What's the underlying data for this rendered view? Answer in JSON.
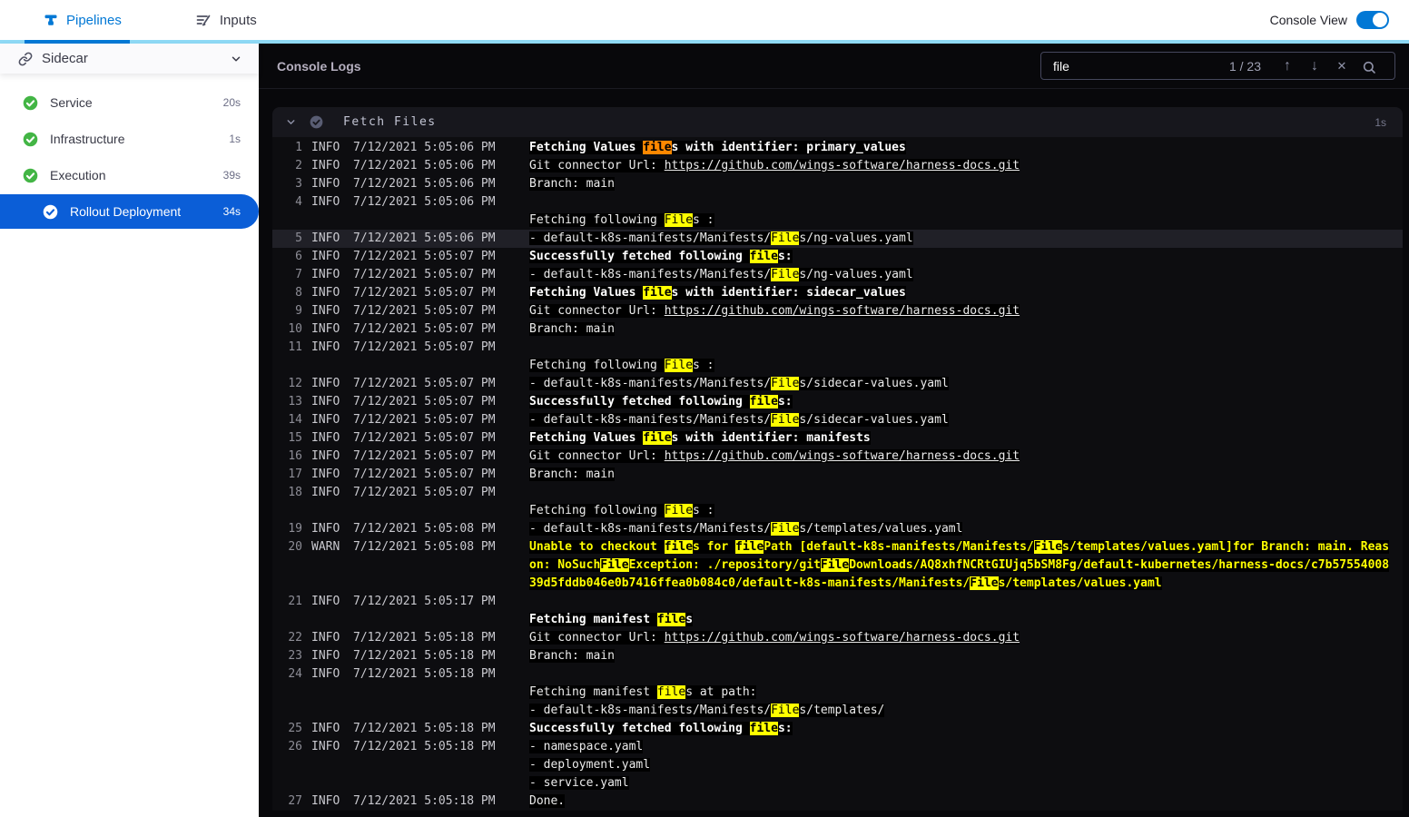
{
  "header": {
    "tabs": [
      {
        "label": "Pipelines",
        "icon": "pipeline-icon",
        "active": true
      },
      {
        "label": "Inputs",
        "icon": "inputs-icon",
        "active": false
      }
    ],
    "console_view_label": "Console View",
    "console_view_on": true
  },
  "sidebar": {
    "stage": {
      "label": "Sidecar",
      "icon": "link-icon"
    },
    "steps": [
      {
        "label": "Service",
        "duration": "20s",
        "status": "success",
        "selected": false
      },
      {
        "label": "Infrastructure",
        "duration": "1s",
        "status": "success",
        "selected": false
      },
      {
        "label": "Execution",
        "duration": "39s",
        "status": "success",
        "selected": false
      },
      {
        "label": "Rollout Deployment",
        "duration": "34s",
        "status": "success",
        "selected": true
      }
    ]
  },
  "console": {
    "title": "Console Logs",
    "search": {
      "value": "file",
      "counter": "1 / 23"
    },
    "section": {
      "title": "Fetch Files",
      "duration": "1s"
    }
  },
  "colors": {
    "accent_blue": "#0278d5",
    "selected_step_blue": "#0b5ed7",
    "success_green": "#43b545",
    "match_highlight": "#ffff00",
    "current_match_highlight": "#ff8800",
    "warn_text": "#ffff00"
  },
  "log": {
    "entries": [
      {
        "num": 1,
        "level": "INFO",
        "time": "7/12/2021 5:05:06 PM",
        "lines": [
          [
            {
              "t": "Fetching Values ",
              "b": 1
            },
            {
              "t": "file",
              "b": 1,
              "m": "current"
            },
            {
              "t": "s with identifier: primary_values",
              "b": 1
            }
          ]
        ]
      },
      {
        "num": 2,
        "level": "INFO",
        "time": "7/12/2021 5:05:06 PM",
        "lines": [
          [
            {
              "t": "Git connector Url: "
            },
            {
              "t": "https://github.com/wings-software/harness-docs.git",
              "link": 1
            }
          ]
        ]
      },
      {
        "num": 3,
        "level": "INFO",
        "time": "7/12/2021 5:05:06 PM",
        "lines": [
          [
            {
              "t": "Branch: main"
            }
          ]
        ]
      },
      {
        "num": 4,
        "level": "INFO",
        "time": "7/12/2021 5:05:06 PM",
        "lines": [
          [],
          [
            {
              "t": "Fetching following "
            },
            {
              "t": "File",
              "m": "match"
            },
            {
              "t": "s :"
            }
          ]
        ]
      },
      {
        "num": 5,
        "level": "INFO",
        "time": "7/12/2021 5:05:06 PM",
        "row_highlight": true,
        "lines": [
          [
            {
              "t": "- default-k8s-manifests/Manifests/"
            },
            {
              "t": "File",
              "m": "match"
            },
            {
              "t": "s/ng-values.yaml"
            }
          ]
        ]
      },
      {
        "num": 6,
        "level": "INFO",
        "time": "7/12/2021 5:05:07 PM",
        "lines": [
          [
            {
              "t": "Successfully fetched following ",
              "b": 1
            },
            {
              "t": "file",
              "b": 1,
              "m": "match"
            },
            {
              "t": "s:",
              "b": 1
            }
          ]
        ]
      },
      {
        "num": 7,
        "level": "INFO",
        "time": "7/12/2021 5:05:07 PM",
        "lines": [
          [
            {
              "t": "- default-k8s-manifests/Manifests/"
            },
            {
              "t": "File",
              "m": "match"
            },
            {
              "t": "s/ng-values.yaml"
            }
          ]
        ]
      },
      {
        "num": 8,
        "level": "INFO",
        "time": "7/12/2021 5:05:07 PM",
        "lines": [
          [
            {
              "t": "Fetching Values ",
              "b": 1
            },
            {
              "t": "file",
              "b": 1,
              "m": "match"
            },
            {
              "t": "s with identifier: sidecar_values",
              "b": 1
            }
          ]
        ]
      },
      {
        "num": 9,
        "level": "INFO",
        "time": "7/12/2021 5:05:07 PM",
        "lines": [
          [
            {
              "t": "Git connector Url: "
            },
            {
              "t": "https://github.com/wings-software/harness-docs.git",
              "link": 1
            }
          ]
        ]
      },
      {
        "num": 10,
        "level": "INFO",
        "time": "7/12/2021 5:05:07 PM",
        "lines": [
          [
            {
              "t": "Branch: main"
            }
          ]
        ]
      },
      {
        "num": 11,
        "level": "INFO",
        "time": "7/12/2021 5:05:07 PM",
        "lines": [
          [],
          [
            {
              "t": "Fetching following "
            },
            {
              "t": "File",
              "m": "match"
            },
            {
              "t": "s :"
            }
          ]
        ]
      },
      {
        "num": 12,
        "level": "INFO",
        "time": "7/12/2021 5:05:07 PM",
        "lines": [
          [
            {
              "t": "- default-k8s-manifests/Manifests/"
            },
            {
              "t": "File",
              "m": "match"
            },
            {
              "t": "s/sidecar-values.yaml"
            }
          ]
        ]
      },
      {
        "num": 13,
        "level": "INFO",
        "time": "7/12/2021 5:05:07 PM",
        "lines": [
          [
            {
              "t": "Successfully fetched following ",
              "b": 1
            },
            {
              "t": "file",
              "b": 1,
              "m": "match"
            },
            {
              "t": "s:",
              "b": 1
            }
          ]
        ]
      },
      {
        "num": 14,
        "level": "INFO",
        "time": "7/12/2021 5:05:07 PM",
        "lines": [
          [
            {
              "t": "- default-k8s-manifests/Manifests/"
            },
            {
              "t": "File",
              "m": "match"
            },
            {
              "t": "s/sidecar-values.yaml"
            }
          ]
        ]
      },
      {
        "num": 15,
        "level": "INFO",
        "time": "7/12/2021 5:05:07 PM",
        "lines": [
          [
            {
              "t": "Fetching Values ",
              "b": 1
            },
            {
              "t": "file",
              "b": 1,
              "m": "match"
            },
            {
              "t": "s with identifier: manifests",
              "b": 1
            }
          ]
        ]
      },
      {
        "num": 16,
        "level": "INFO",
        "time": "7/12/2021 5:05:07 PM",
        "lines": [
          [
            {
              "t": "Git connector Url: "
            },
            {
              "t": "https://github.com/wings-software/harness-docs.git",
              "link": 1
            }
          ]
        ]
      },
      {
        "num": 17,
        "level": "INFO",
        "time": "7/12/2021 5:05:07 PM",
        "lines": [
          [
            {
              "t": "Branch: main"
            }
          ]
        ]
      },
      {
        "num": 18,
        "level": "INFO",
        "time": "7/12/2021 5:05:07 PM",
        "lines": [
          [],
          [
            {
              "t": "Fetching following "
            },
            {
              "t": "File",
              "m": "match"
            },
            {
              "t": "s :"
            }
          ]
        ]
      },
      {
        "num": 19,
        "level": "INFO",
        "time": "7/12/2021 5:05:08 PM",
        "lines": [
          [
            {
              "t": "- default-k8s-manifests/Manifests/"
            },
            {
              "t": "File",
              "m": "match"
            },
            {
              "t": "s/templates/values.yaml"
            }
          ]
        ]
      },
      {
        "num": 20,
        "level": "WARN",
        "time": "7/12/2021 5:05:08 PM",
        "lines": [
          [
            {
              "t": "Unable to checkout ",
              "w": 1,
              "b": 1
            },
            {
              "t": "file",
              "m": "match",
              "b": 1
            },
            {
              "t": "s for ",
              "w": 1,
              "b": 1
            },
            {
              "t": "file",
              "m": "match",
              "b": 1
            },
            {
              "t": "Path [default-k8s-manifests/Manifests/",
              "w": 1,
              "b": 1
            },
            {
              "t": "File",
              "m": "match",
              "b": 1
            },
            {
              "t": "s/templates/values.yaml]for Branch: main. Reason: NoSuch",
              "w": 1,
              "b": 1
            },
            {
              "t": "File",
              "m": "match",
              "b": 1
            },
            {
              "t": "Exception: ./repository/git",
              "w": 1,
              "b": 1
            },
            {
              "t": "File",
              "m": "match",
              "b": 1
            },
            {
              "t": "Downloads/AQ8xhfNCRtGIUjq5bSM8Fg/default-kubernetes/harness-docs/c7b5755400839d5fddb046e0b7416ffea0b084c0/default-k8s-manifests/Manifests/",
              "w": 1,
              "b": 1
            },
            {
              "t": "File",
              "m": "match",
              "b": 1
            },
            {
              "t": "s/templates/values.yaml",
              "w": 1,
              "b": 1
            }
          ]
        ]
      },
      {
        "num": 21,
        "level": "INFO",
        "time": "7/12/2021 5:05:17 PM",
        "lines": [
          [],
          [
            {
              "t": "Fetching manifest ",
              "b": 1
            },
            {
              "t": "file",
              "b": 1,
              "m": "match"
            },
            {
              "t": "s",
              "b": 1
            }
          ]
        ]
      },
      {
        "num": 22,
        "level": "INFO",
        "time": "7/12/2021 5:05:18 PM",
        "lines": [
          [
            {
              "t": "Git connector Url: "
            },
            {
              "t": "https://github.com/wings-software/harness-docs.git",
              "link": 1
            }
          ]
        ]
      },
      {
        "num": 23,
        "level": "INFO",
        "time": "7/12/2021 5:05:18 PM",
        "lines": [
          [
            {
              "t": "Branch: main"
            }
          ]
        ]
      },
      {
        "num": 24,
        "level": "INFO",
        "time": "7/12/2021 5:05:18 PM",
        "lines": [
          [],
          [
            {
              "t": "Fetching manifest "
            },
            {
              "t": "file",
              "m": "match"
            },
            {
              "t": "s at path:"
            }
          ],
          [
            {
              "t": "- default-k8s-manifests/Manifests/"
            },
            {
              "t": "File",
              "m": "match"
            },
            {
              "t": "s/templates/"
            }
          ]
        ]
      },
      {
        "num": 25,
        "level": "INFO",
        "time": "7/12/2021 5:05:18 PM",
        "lines": [
          [
            {
              "t": "Successfully fetched following ",
              "b": 1
            },
            {
              "t": "file",
              "b": 1,
              "m": "match"
            },
            {
              "t": "s:",
              "b": 1
            }
          ]
        ]
      },
      {
        "num": 26,
        "level": "INFO",
        "time": "7/12/2021 5:05:18 PM",
        "lines": [
          [
            {
              "t": "- namespace.yaml"
            }
          ],
          [
            {
              "t": "- deployment.yaml"
            }
          ],
          [
            {
              "t": "- service.yaml"
            }
          ]
        ]
      },
      {
        "num": 27,
        "level": "INFO",
        "time": "7/12/2021 5:05:18 PM",
        "lines": [
          [
            {
              "t": "Done."
            }
          ]
        ]
      }
    ]
  }
}
